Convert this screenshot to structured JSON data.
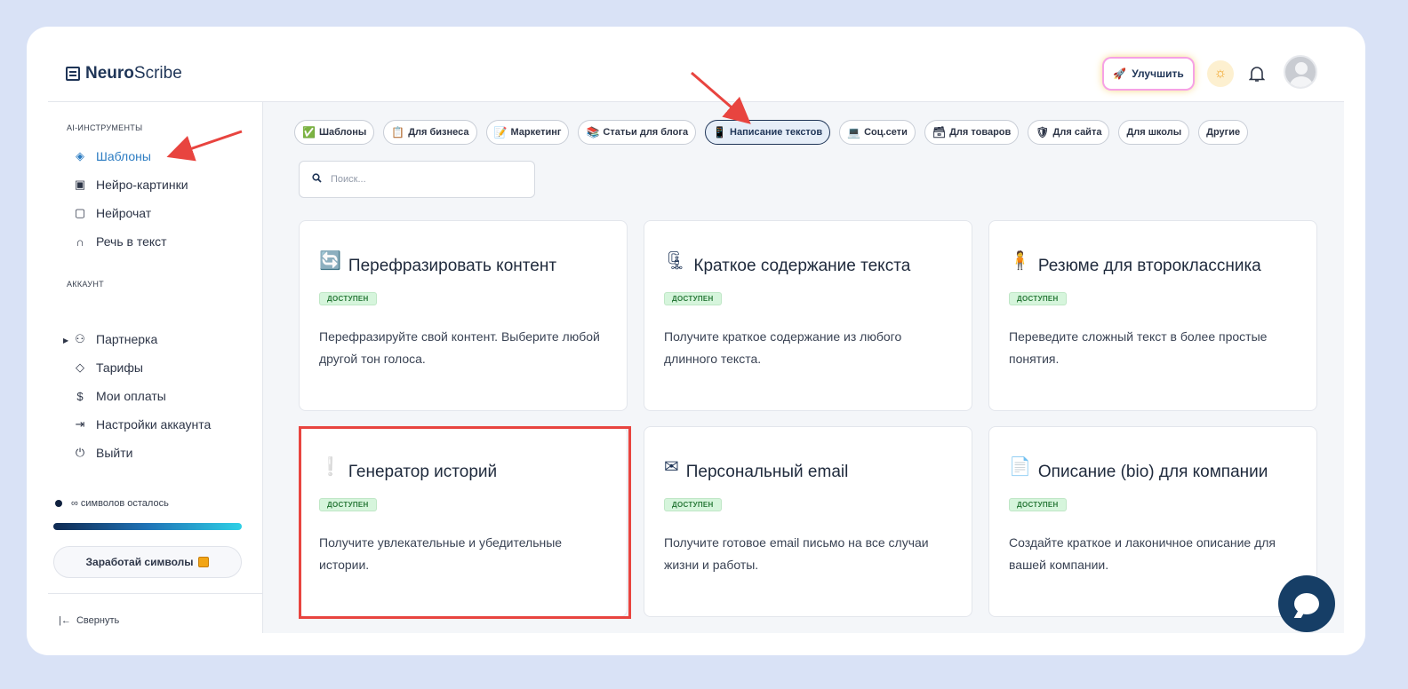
{
  "app": {
    "brand_bold": "Neuro",
    "brand_light": "Scribe"
  },
  "header": {
    "upgrade_label": "Улучшить"
  },
  "sidebar": {
    "section_tools": "AI-ИНСТРУМЕНТЫ",
    "tools": [
      {
        "label": "Шаблоны",
        "icon": "layers-icon"
      },
      {
        "label": "Нейро-картинки",
        "icon": "image-icon"
      },
      {
        "label": "Нейрочат",
        "icon": "chat-icon"
      },
      {
        "label": "Речь в текст",
        "icon": "headphones-icon"
      }
    ],
    "section_account": "АККАУНТ",
    "account": [
      {
        "label": "Партнерка",
        "icon": "users-icon"
      },
      {
        "label": "Тарифы",
        "icon": "tag-icon"
      },
      {
        "label": "Мои оплаты",
        "icon": "dollar-icon"
      },
      {
        "label": "Настройки аккаунта",
        "icon": "logout-icon"
      },
      {
        "label": "Выйти",
        "icon": "power-icon"
      }
    ],
    "symbols_left": "∞ символов осталось",
    "earn_label": "Заработай символы",
    "collapse_label": "Свернуть"
  },
  "chips": [
    {
      "label": "Шаблоны",
      "icon": "✅"
    },
    {
      "label": "Для бизнеса",
      "icon": "📋"
    },
    {
      "label": "Маркетинг",
      "icon": "📝"
    },
    {
      "label": "Статьи для блога",
      "icon": "📚"
    },
    {
      "label": "Написание текстов",
      "icon": "📱"
    },
    {
      "label": "Соц.сети",
      "icon": "💻"
    },
    {
      "label": "Для товаров",
      "icon": "🗃"
    },
    {
      "label": "Для сайта",
      "icon": "🛡"
    },
    {
      "label": "Для школы",
      "icon": ""
    },
    {
      "label": "Другие",
      "icon": ""
    }
  ],
  "active_chip": "Написание текстов",
  "search": {
    "placeholder": "Поиск..."
  },
  "status_badge": "ДОСТУПЕН",
  "cards": [
    {
      "title": "Перефразировать контент",
      "emoji": "🔄",
      "desc": "Перефразируйте свой контент. Выберите любой другой тон голоса."
    },
    {
      "title": "Краткое содержание текста",
      "emoji": "🗜",
      "desc": "Получите краткое содержание из любого длинного текста."
    },
    {
      "title": "Резюме для второклассника",
      "emoji": "🧍",
      "desc": "Переведите сложный текст в более простые понятия."
    },
    {
      "title": "Генератор историй",
      "emoji": "❕",
      "desc": "Получите увлекательные и убедительные истории."
    },
    {
      "title": "Персональный email",
      "emoji": "✉",
      "desc": "Получите готовое email письмо на все случаи жизни и работы."
    },
    {
      "title": "Описание (bio) для компании",
      "emoji": "📄",
      "desc": "Создайте краткое и лаконичное описание для вашей компании."
    }
  ],
  "colors": {
    "accent": "#2c7cc2",
    "navy": "#1f3557",
    "annotation": "#e8443f",
    "badge_bg": "#d6f5dc"
  }
}
